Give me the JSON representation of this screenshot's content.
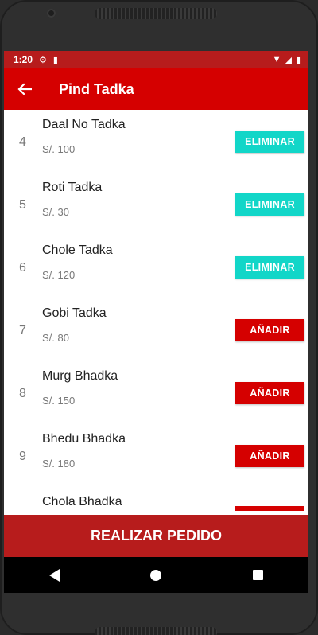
{
  "status_bar": {
    "time": "1:20"
  },
  "app_bar": {
    "title": "Pind Tadka"
  },
  "items": [
    {
      "number": "4",
      "name": "Daal No Tadka",
      "price": "S/. 100",
      "action": "ELIMINAR"
    },
    {
      "number": "5",
      "name": "Roti Tadka",
      "price": "S/. 30",
      "action": "ELIMINAR"
    },
    {
      "number": "6",
      "name": "Chole Tadka",
      "price": "S/. 120",
      "action": "ELIMINAR"
    },
    {
      "number": "7",
      "name": "Gobi Tadka",
      "price": "S/. 80",
      "action": "AÑADIR"
    },
    {
      "number": "8",
      "name": "Murg Bhadka",
      "price": "S/. 150",
      "action": "AÑADIR"
    },
    {
      "number": "9",
      "name": "Bhedu Bhadka",
      "price": "S/. 180",
      "action": "AÑADIR"
    },
    {
      "name": "Chola Bhadka"
    }
  ],
  "order_button": {
    "label": "REALIZAR PEDIDO"
  },
  "colors": {
    "primary": "#d50000",
    "primary_dark": "#b71c1c",
    "remove": "#12d6c8"
  }
}
